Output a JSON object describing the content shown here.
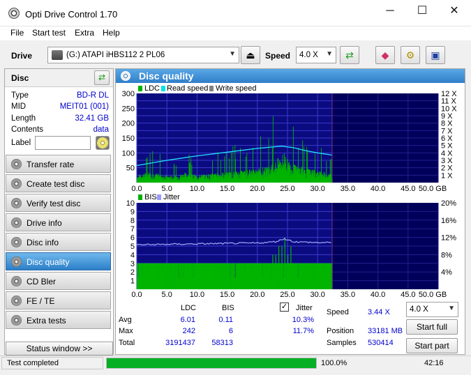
{
  "window": {
    "title": "Opti Drive Control 1.70",
    "minimize": "─",
    "maximize": "☐",
    "close": "✕"
  },
  "menu": [
    "File",
    "Start test",
    "Extra",
    "Help"
  ],
  "toolbar": {
    "drive_label": "Drive",
    "drive_value": "(G:)  ATAPI iHBS112  2 PL06",
    "speed_label": "Speed",
    "speed_value": "4.0 X"
  },
  "disc": {
    "header": "Disc",
    "rows": [
      {
        "key": "Type",
        "value": "BD-R DL"
      },
      {
        "key": "MID",
        "value": "MEIT01 (001)"
      },
      {
        "key": "Length",
        "value": "32.41 GB"
      },
      {
        "key": "Contents",
        "value": "data"
      }
    ],
    "label_key": "Label",
    "label_value": ""
  },
  "nav": [
    "Transfer rate",
    "Create test disc",
    "Verify test disc",
    "Drive info",
    "Disc info",
    "Disc quality",
    "CD Bler",
    "FE / TE",
    "Extra tests"
  ],
  "nav_active": 5,
  "status_window": "Status window >>",
  "panel_title": "Disc quality",
  "charts": {
    "top": {
      "legend": [
        "LDC",
        "Read speed",
        "Write speed"
      ],
      "legend_colors": [
        "#00b000",
        "#00e5e5",
        "#808080"
      ],
      "y_ticks": [
        "300",
        "250",
        "200",
        "150",
        "100",
        "50"
      ],
      "y2_ticks": [
        "12 X",
        "11 X",
        "10 X",
        "9 X",
        "8 X",
        "7 X",
        "6 X",
        "5 X",
        "4 X",
        "3 X",
        "2 X",
        "1 X"
      ],
      "x_ticks": [
        "0.0",
        "5.0",
        "10.0",
        "15.0",
        "20.0",
        "25.0",
        "30.0",
        "35.0",
        "40.0",
        "45.0",
        "50.0 GB"
      ]
    },
    "bottom": {
      "legend": [
        "BIS",
        "Jitter"
      ],
      "legend_colors": [
        "#00b000",
        "#9999ff"
      ],
      "y_ticks": [
        "10",
        "9",
        "8",
        "7",
        "6",
        "5",
        "4",
        "3",
        "2",
        "1"
      ],
      "y2_ticks": [
        "20%",
        "16%",
        "12%",
        "8%",
        "4%"
      ],
      "x_ticks": [
        "0.0",
        "5.0",
        "10.0",
        "15.0",
        "20.0",
        "25.0",
        "30.0",
        "35.0",
        "40.0",
        "45.0",
        "50.0 GB"
      ]
    }
  },
  "chart_data": [
    {
      "type": "bar",
      "title": "",
      "legend": [
        "LDC",
        "Read speed",
        "Write speed"
      ],
      "xlim": [
        0,
        50
      ],
      "ylim": [
        0,
        300
      ],
      "y2lim": [
        0,
        12
      ],
      "disc_end_gb": 32.41,
      "ldc_envelope": {
        "x": [
          0,
          2,
          4,
          6,
          8,
          10,
          12,
          14,
          16,
          18,
          20,
          22,
          23,
          24,
          24.5,
          25,
          26,
          28,
          30,
          32.4
        ],
        "y": [
          25,
          38,
          28,
          22,
          34,
          26,
          30,
          35,
          38,
          42,
          48,
          55,
          75,
          95,
          110,
          78,
          62,
          50,
          40,
          30
        ]
      },
      "read_speed": {
        "x": [
          0,
          5,
          10,
          15,
          20,
          24,
          26,
          28,
          30,
          32.4
        ],
        "y": [
          2.3,
          3.0,
          3.6,
          4.1,
          4.6,
          4.9,
          4.7,
          4.3,
          4.0,
          3.7
        ]
      }
    },
    {
      "type": "bar",
      "title": "",
      "legend": [
        "BIS",
        "Jitter"
      ],
      "xlim": [
        0,
        50
      ],
      "ylim": [
        0,
        10
      ],
      "y2lim": [
        0,
        20
      ],
      "disc_end_gb": 32.41,
      "bis_baseline": 3,
      "bis_spikes": {
        "x": [
          22.5,
          23,
          23.5,
          24,
          24.5,
          25,
          25.5
        ],
        "y": [
          4,
          4,
          5,
          5,
          6,
          4,
          5
        ]
      },
      "jitter": {
        "x": [
          0,
          5,
          10,
          15,
          20,
          23,
          24.5,
          26,
          28,
          30,
          32.4
        ],
        "y": [
          10.3,
          10.4,
          10.5,
          10.6,
          10.7,
          11.0,
          11.7,
          11.0,
          10.9,
          10.8,
          10.8
        ]
      }
    }
  ],
  "stats": {
    "hdr_ldc": "LDC",
    "hdr_bis": "BIS",
    "hdr_jitter": "Jitter",
    "jitter_checked": true,
    "rows": [
      {
        "label": "Avg",
        "ldc": "6.01",
        "bis": "0.11",
        "jitter": "10.3%"
      },
      {
        "label": "Max",
        "ldc": "242",
        "bis": "6",
        "jitter": "11.7%"
      },
      {
        "label": "Total",
        "ldc": "3191437",
        "bis": "58313",
        "jitter": ""
      }
    ],
    "speed_label": "Speed",
    "speed_value": "3.44 X",
    "position_label": "Position",
    "position_value": "33181 MB",
    "samples_label": "Samples",
    "samples_value": "530414",
    "speed_select": "4.0 X",
    "start_full": "Start full",
    "start_part": "Start part"
  },
  "status": {
    "text": "Test completed",
    "progress": 100.0,
    "progress_text": "100.0%",
    "time": "42:16"
  }
}
